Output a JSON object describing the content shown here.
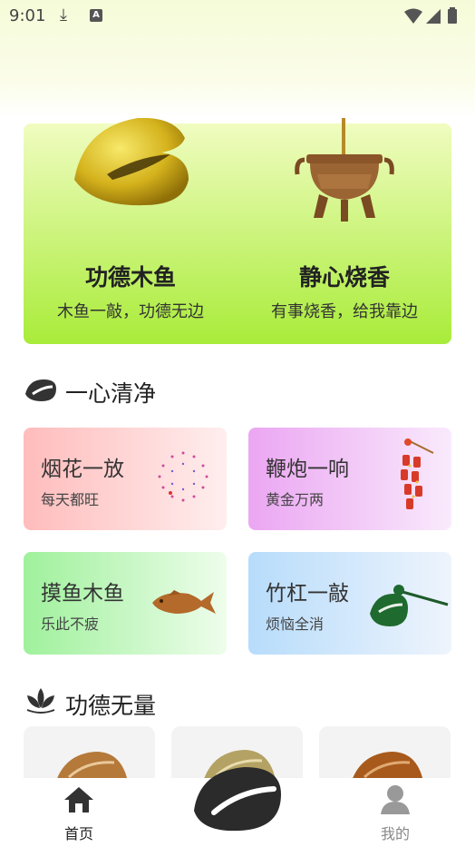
{
  "status_bar": {
    "time": "9:01",
    "download_glyph": "⤓",
    "a_badge": "A"
  },
  "hero": [
    {
      "title": "功德木鱼",
      "subtitle": "木鱼一敲，功德无边",
      "icon": "wooden-fish-icon"
    },
    {
      "title": "静心烧香",
      "subtitle": "有事烧香，给我靠边",
      "icon": "incense-burner-icon"
    }
  ],
  "sections": {
    "pure_mind": "一心清净",
    "merit": "功德无量"
  },
  "cards": [
    {
      "title": "烟花一放",
      "subtitle": "每天都旺",
      "icon": "firework-icon"
    },
    {
      "title": "鞭炮一响",
      "subtitle": "黄金万两",
      "icon": "firecracker-icon"
    },
    {
      "title": "摸鱼木鱼",
      "subtitle": "乐此不疲",
      "icon": "fish-icon"
    },
    {
      "title": "竹杠一敲",
      "subtitle": "烦恼全消",
      "icon": "bamboo-knock-icon"
    }
  ],
  "tabs": [
    {
      "label": "首页",
      "icon": "home-icon",
      "active": true
    },
    {
      "label": "",
      "icon": "wooden-fish-icon",
      "active": false
    },
    {
      "label": "我的",
      "icon": "profile-icon",
      "active": false
    }
  ],
  "colors": {
    "accent_green": "#a9ec3a",
    "text_dark": "#222222",
    "tab_inactive": "#888888"
  }
}
